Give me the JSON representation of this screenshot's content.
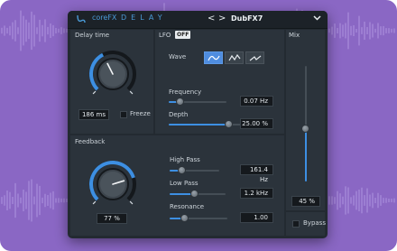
{
  "header": {
    "brand": "coreFX",
    "product": "DELAY",
    "prev_label": "<",
    "next_label": ">",
    "preset_name": "DubFX7",
    "preset_menu_icon": "chevron-down-icon"
  },
  "delay_time": {
    "title": "Delay time",
    "value": "186 ms",
    "knob_level": 0.4,
    "freeze_label": "Freeze",
    "freeze_checked": false
  },
  "feedback": {
    "title": "Feedback",
    "value": "77 %",
    "knob_level": 0.77
  },
  "lfo": {
    "title": "LFO",
    "state": "OFF",
    "wave_label": "Wave",
    "waves": [
      "sine-wave-icon",
      "triangle-wave-icon",
      "sawtooth-wave-icon"
    ],
    "selected_wave": 0,
    "frequency": {
      "label": "Frequency",
      "value": "0.07 Hz",
      "level": 0.2
    },
    "depth": {
      "label": "Depth",
      "value": "25.00 %",
      "level": 0.82
    }
  },
  "filters": {
    "high_pass": {
      "label": "High Pass",
      "value": "161.4 Hz",
      "level": 0.25
    },
    "low_pass": {
      "label": "Low Pass",
      "value": "1.2 kHz",
      "level": 0.45
    },
    "resonance": {
      "label": "Resonance",
      "value": "1.00",
      "level": 0.27
    }
  },
  "mix": {
    "title": "Mix",
    "value": "45 %",
    "level": 0.45
  },
  "bypass": {
    "label": "Bypass",
    "checked": false
  },
  "colors": {
    "background": "#8a67c4",
    "accent": "#3d8fe2",
    "panel": "#2b333b",
    "frame": "#232a31"
  }
}
